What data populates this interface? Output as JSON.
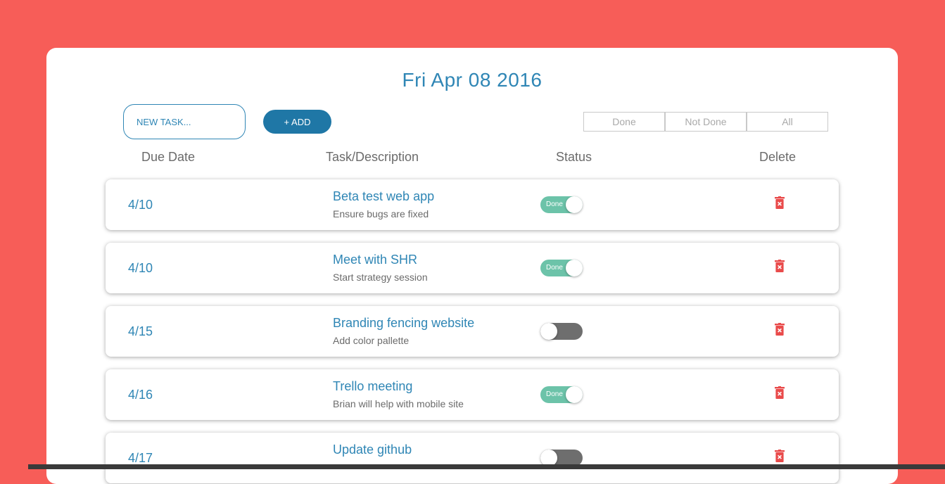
{
  "header": {
    "date": "Fri Apr 08 2016"
  },
  "new_task": {
    "placeholder": "NEW TASK...",
    "add_label": "+ ADD"
  },
  "filters": {
    "done": "Done",
    "not_done": "Not Done",
    "all": "All"
  },
  "columns": {
    "due_date": "Due Date",
    "task": "Task/Description",
    "status": "Status",
    "delete": "Delete"
  },
  "status_label": "Done",
  "colors": {
    "background": "#f75d58",
    "accent": "#2f86b5",
    "toggle_on": "#6cc3a9",
    "toggle_off": "#6e6e6e",
    "delete": "#e94b4b"
  },
  "tasks": [
    {
      "due": "4/10",
      "title": "Beta test web app",
      "desc": "Ensure bugs are fixed",
      "done": true
    },
    {
      "due": "4/10",
      "title": "Meet with SHR",
      "desc": "Start strategy session",
      "done": true
    },
    {
      "due": "4/15",
      "title": "Branding fencing website",
      "desc": "Add color pallette",
      "done": false
    },
    {
      "due": "4/16",
      "title": "Trello meeting",
      "desc": "Brian will help with mobile site",
      "done": true
    },
    {
      "due": "4/17",
      "title": "Update github",
      "desc": "",
      "done": false
    }
  ]
}
